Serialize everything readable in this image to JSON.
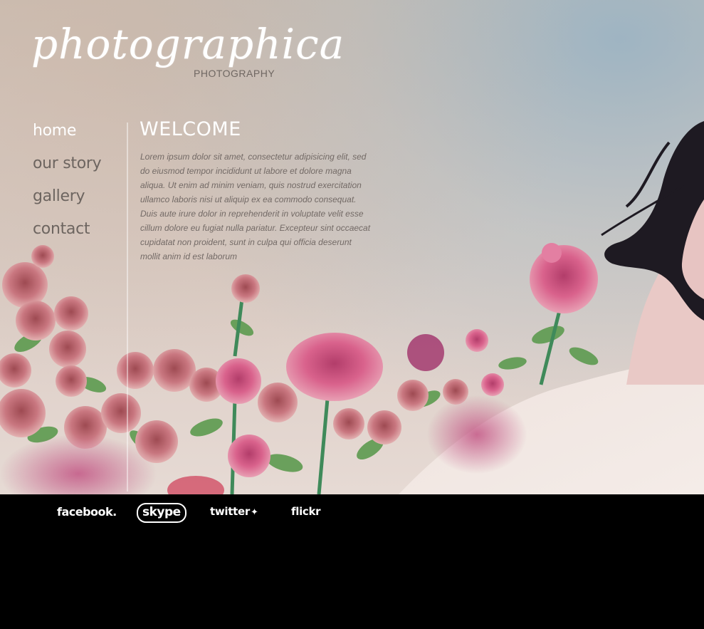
{
  "brand": {
    "logo": "photographica",
    "tagline": "PHOTOGRAPHY"
  },
  "nav": {
    "items": [
      "home",
      "our story",
      "gallery",
      "contact"
    ],
    "active": "home"
  },
  "content": {
    "heading": "WELCOME",
    "body": "Lorem ipsum dolor sit amet, consectetur adipisicing elit, sed do eiusmod tempor incididunt ut labore et dolore magna aliqua. Ut enim ad minim veniam, quis nostrud exercitation ullamco laboris nisi ut aliquip ex ea commodo consequat. Duis aute irure dolor in reprehenderit in voluptate velit esse cillum dolore eu fugiat nulla pariatur. Excepteur sint occaecat cupidatat non proident, sunt in culpa qui officia deserunt mollit anim id est laborum"
  },
  "social": {
    "facebook": "facebook.",
    "skype": "skype",
    "twitter": "twitter",
    "flickr": "flickr"
  },
  "icons": {
    "twitter_bird": "bird-icon"
  },
  "colors": {
    "background_top": "#cdbfb4",
    "nav_text": "#6d6560",
    "active_text": "#ffffff",
    "footer_bg": "#000000"
  }
}
